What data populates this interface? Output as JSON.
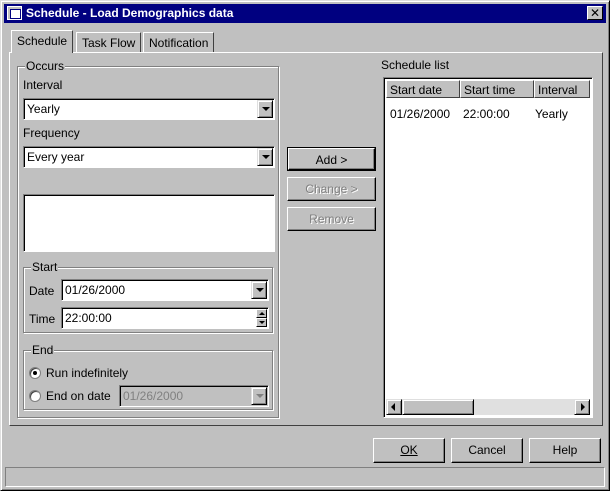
{
  "window": {
    "title": "Schedule - Load Demographics data",
    "close_glyph": "✕"
  },
  "tabs": [
    {
      "label": "Schedule",
      "active": true
    },
    {
      "label": "Task Flow",
      "active": false
    },
    {
      "label": "Notification",
      "active": false
    }
  ],
  "occurs": {
    "group_label": "Occurs",
    "interval_label": "Interval",
    "interval_value": "Yearly",
    "frequency_label": "Frequency",
    "frequency_value": "Every year"
  },
  "start": {
    "group_label": "Start",
    "date_label": "Date",
    "date_value": "01/26/2000",
    "time_label": "Time",
    "time_value": "22:00:00"
  },
  "end": {
    "group_label": "End",
    "run_indefinitely_label": "Run indefinitely",
    "end_on_date_label": "End on date",
    "end_date_value": "01/26/2000",
    "selected": "run_indefinitely"
  },
  "actions": {
    "add_label": "Add >",
    "change_label": "Change >",
    "remove_label": "Remove"
  },
  "schedule_list": {
    "label": "Schedule list",
    "columns": [
      "Start date",
      "Start time",
      "Interval"
    ],
    "rows": [
      [
        "01/26/2000",
        "22:00:00",
        "Yearly"
      ]
    ]
  },
  "footer": {
    "ok_label": "OK",
    "cancel_label": "Cancel",
    "help_label": "Help"
  },
  "colors": {
    "titlebar": "#000080",
    "face": "#c0c0c0",
    "disabled_text": "#808080"
  }
}
